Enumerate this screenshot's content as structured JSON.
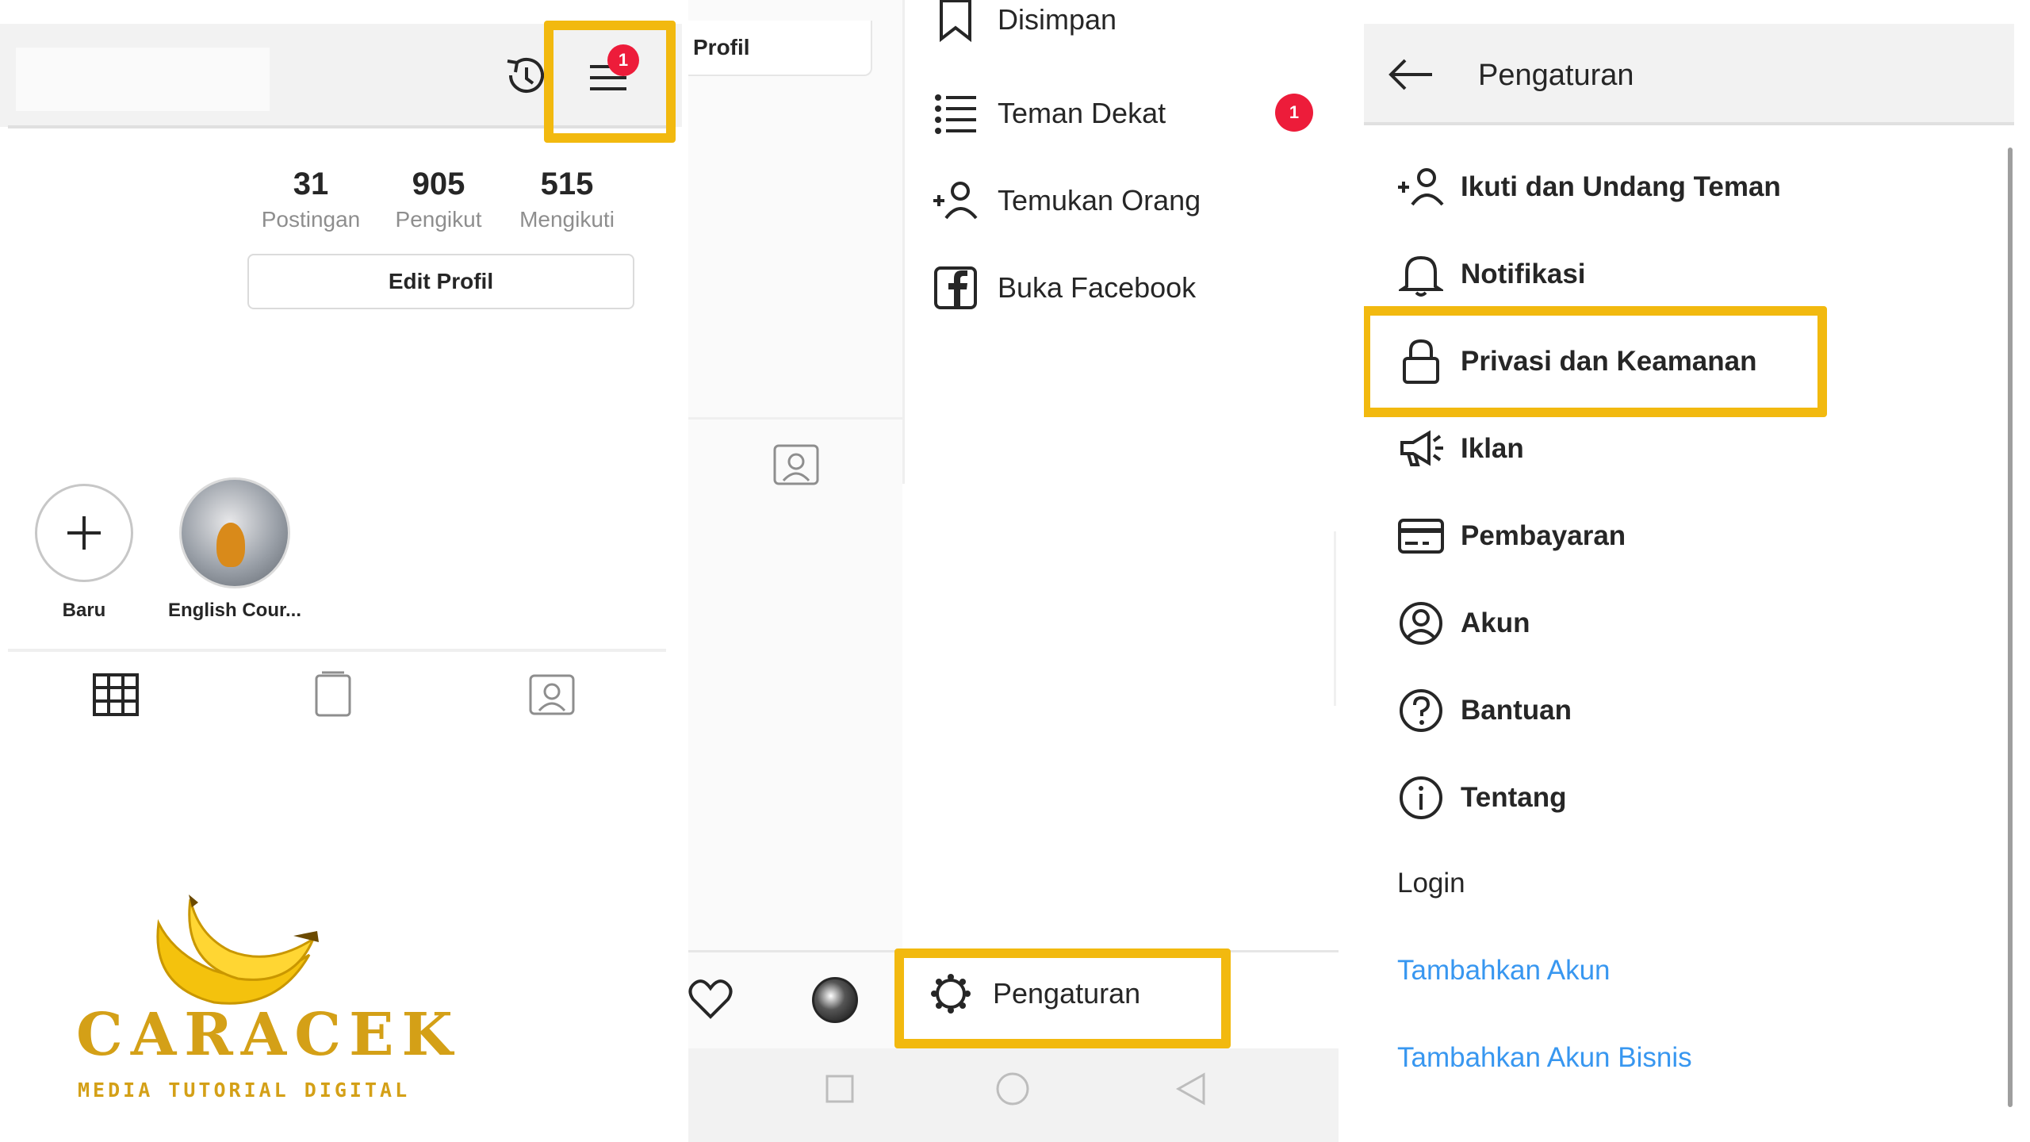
{
  "profile": {
    "edit_tab_label": "Profil",
    "stats": [
      {
        "value": "31",
        "label": "Postingan"
      },
      {
        "value": "905",
        "label": "Pengikut"
      },
      {
        "value": "515",
        "label": "Mengikuti"
      }
    ],
    "edit_button": "Edit Profil",
    "menu_badge": "1",
    "highlights": [
      {
        "label": "Baru"
      },
      {
        "label": "English Cour..."
      }
    ]
  },
  "drawer": {
    "items": [
      {
        "label": "Disimpan",
        "icon": "bookmark-icon"
      },
      {
        "label": "Teman Dekat",
        "icon": "list-icon",
        "badge": "1"
      },
      {
        "label": "Temukan Orang",
        "icon": "add-person-icon"
      },
      {
        "label": "Buka Facebook",
        "icon": "facebook-icon"
      }
    ],
    "settings_label": "Pengaturan"
  },
  "settings": {
    "title": "Pengaturan",
    "items": [
      {
        "label": "Ikuti dan Undang Teman",
        "icon": "add-person-icon"
      },
      {
        "label": "Notifikasi",
        "icon": "bell-icon"
      },
      {
        "label": "Privasi dan Keamanan",
        "icon": "lock-icon"
      },
      {
        "label": "Iklan",
        "icon": "megaphone-icon"
      },
      {
        "label": "Pembayaran",
        "icon": "card-icon"
      },
      {
        "label": "Akun",
        "icon": "account-icon"
      },
      {
        "label": "Bantuan",
        "icon": "help-icon"
      },
      {
        "label": "Tentang",
        "icon": "info-icon"
      }
    ],
    "login_header": "Login",
    "links": [
      "Tambahkan Akun",
      "Tambahkan Akun Bisnis"
    ]
  },
  "watermark": {
    "brand": "CARACEK",
    "tagline": "MEDIA TUTORIAL DIGITAL"
  },
  "colors": {
    "highlight": "#f2b90f",
    "badge": "#ed1c3a",
    "link": "#3897f0"
  }
}
